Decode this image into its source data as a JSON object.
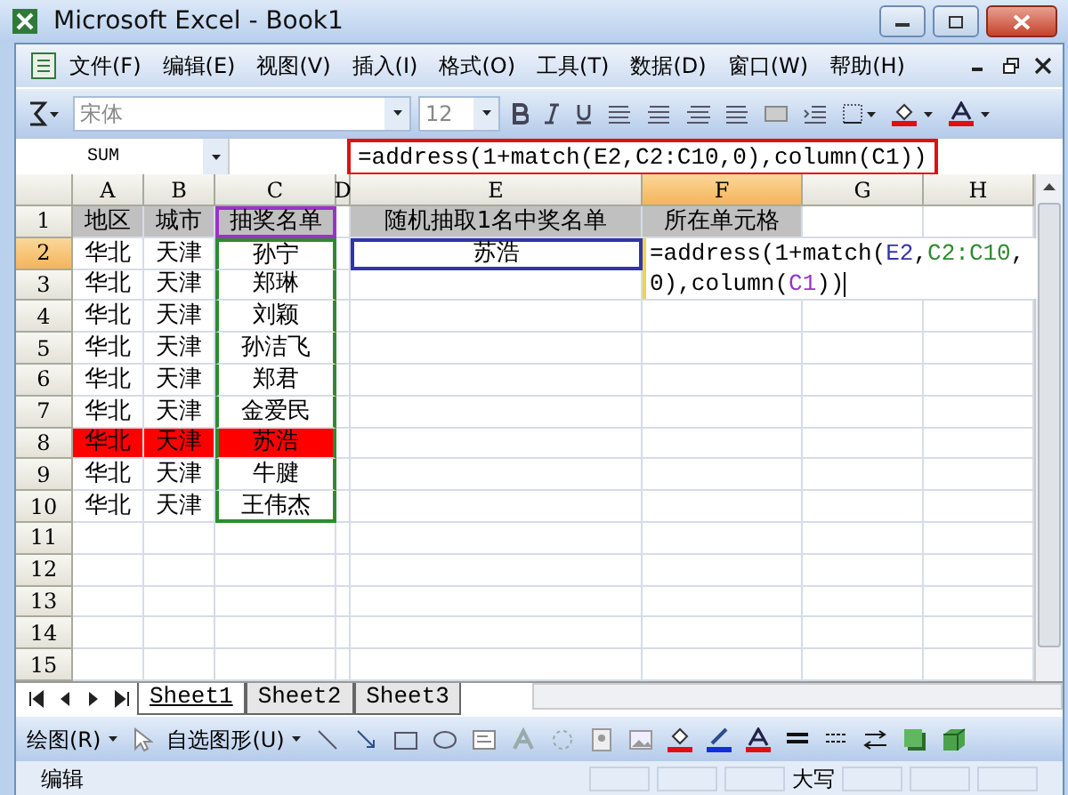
{
  "window": {
    "title": "Microsoft Excel - Book1"
  },
  "menu": [
    {
      "label": "文件(F)"
    },
    {
      "label": "编辑(E)"
    },
    {
      "label": "视图(V)"
    },
    {
      "label": "插入(I)"
    },
    {
      "label": "格式(O)"
    },
    {
      "label": "工具(T)"
    },
    {
      "label": "数据(D)"
    },
    {
      "label": "窗口(W)"
    },
    {
      "label": "帮助(H)"
    }
  ],
  "toolbar": {
    "font_name": "宋体",
    "font_size": "12"
  },
  "formula_bar": {
    "name_box": "SUM",
    "formula": "=address(1+match(E2,C2:C10,0),column(C1))"
  },
  "columns": [
    {
      "label": "A",
      "selected": false
    },
    {
      "label": "B",
      "selected": false
    },
    {
      "label": "C",
      "selected": false
    },
    {
      "label": "D",
      "selected": false
    },
    {
      "label": "E",
      "selected": false
    },
    {
      "label": "F",
      "selected": true
    },
    {
      "label": "G",
      "selected": false
    },
    {
      "label": "H",
      "selected": false
    }
  ],
  "rows": [
    {
      "number": "1",
      "selected": false,
      "cells": [
        {
          "text": "地区",
          "kind": "heading"
        },
        {
          "text": "城市",
          "kind": "heading"
        },
        {
          "text": "抽奖名单",
          "kind": "heading",
          "color": "#9933cc"
        },
        null,
        {
          "text": "随机抽取1名中奖名单",
          "kind": "heading"
        },
        {
          "text": "所在单元格",
          "kind": "heading"
        },
        null,
        null
      ]
    },
    {
      "number": "2",
      "selected": true,
      "cells": [
        {
          "text": "华北"
        },
        {
          "text": "天津"
        },
        {
          "text": "孙宁",
          "color": "#2e8b2e"
        },
        null,
        {
          "text": "苏浩",
          "color": "#3333aa"
        },
        null,
        null,
        null
      ]
    },
    {
      "number": "3",
      "selected": false,
      "cells": [
        {
          "text": "华北"
        },
        {
          "text": "天津"
        },
        {
          "text": "郑琳",
          "color": "#2e8b2e"
        },
        null,
        null,
        null,
        null,
        null
      ]
    },
    {
      "number": "4",
      "selected": false,
      "cells": [
        {
          "text": "华北"
        },
        {
          "text": "天津"
        },
        {
          "text": "刘颖",
          "color": "#2e8b2e"
        },
        null,
        null,
        null,
        null,
        null
      ]
    },
    {
      "number": "5",
      "selected": false,
      "cells": [
        {
          "text": "华北"
        },
        {
          "text": "天津"
        },
        {
          "text": "孙洁飞",
          "color": "#2e8b2e"
        },
        null,
        null,
        null,
        null,
        null
      ]
    },
    {
      "number": "6",
      "selected": false,
      "cells": [
        {
          "text": "华北"
        },
        {
          "text": "天津"
        },
        {
          "text": "郑君",
          "color": "#2e8b2e"
        },
        null,
        null,
        null,
        null,
        null
      ]
    },
    {
      "number": "7",
      "selected": false,
      "cells": [
        {
          "text": "华北"
        },
        {
          "text": "天津"
        },
        {
          "text": "金爱民",
          "color": "#2e8b2e"
        },
        null,
        null,
        null,
        null,
        null
      ]
    },
    {
      "number": "8",
      "selected": false,
      "cells": [
        {
          "text": "华北",
          "kind": "marked"
        },
        {
          "text": "天津",
          "kind": "marked"
        },
        {
          "text": "苏浩",
          "kind": "marked",
          "color": "#2e8b2e"
        },
        null,
        null,
        null,
        null,
        null
      ]
    },
    {
      "number": "9",
      "selected": false,
      "cells": [
        {
          "text": "华北"
        },
        {
          "text": "天津"
        },
        {
          "text": "牛腱",
          "color": "#2e8b2e"
        },
        null,
        null,
        null,
        null,
        null
      ]
    },
    {
      "number": "10",
      "selected": false,
      "cells": [
        {
          "text": "华北"
        },
        {
          "text": "天津"
        },
        {
          "text": "王伟杰",
          "color": "#2e8b2e"
        },
        null,
        null,
        null,
        null,
        null
      ]
    },
    {
      "number": "11",
      "selected": false
    },
    {
      "number": "12",
      "selected": false
    },
    {
      "number": "13",
      "selected": false
    },
    {
      "number": "14",
      "selected": false
    },
    {
      "number": "15",
      "selected": false
    }
  ],
  "cell_editor": {
    "segments": [
      {
        "text": "=address(1+match("
      },
      {
        "text": "E2",
        "color": "#3333aa"
      },
      {
        "text": ","
      },
      {
        "text": "C2:C10",
        "color": "#2e8b2e"
      },
      {
        "text": ",0),column("
      },
      {
        "text": "C1",
        "color": "#9933cc"
      },
      {
        "text": "))"
      }
    ]
  },
  "sheet_tabs": [
    {
      "label": "Sheet1",
      "selected": true
    },
    {
      "label": "Sheet2",
      "selected": false
    },
    {
      "label": "Sheet3",
      "selected": false
    }
  ],
  "drawing_toolbar": {
    "draw_menu": "绘图(R)",
    "autoshapes_menu": "自选图形(U)"
  },
  "status_bar": {
    "mode": "编辑",
    "caps": "大写"
  }
}
